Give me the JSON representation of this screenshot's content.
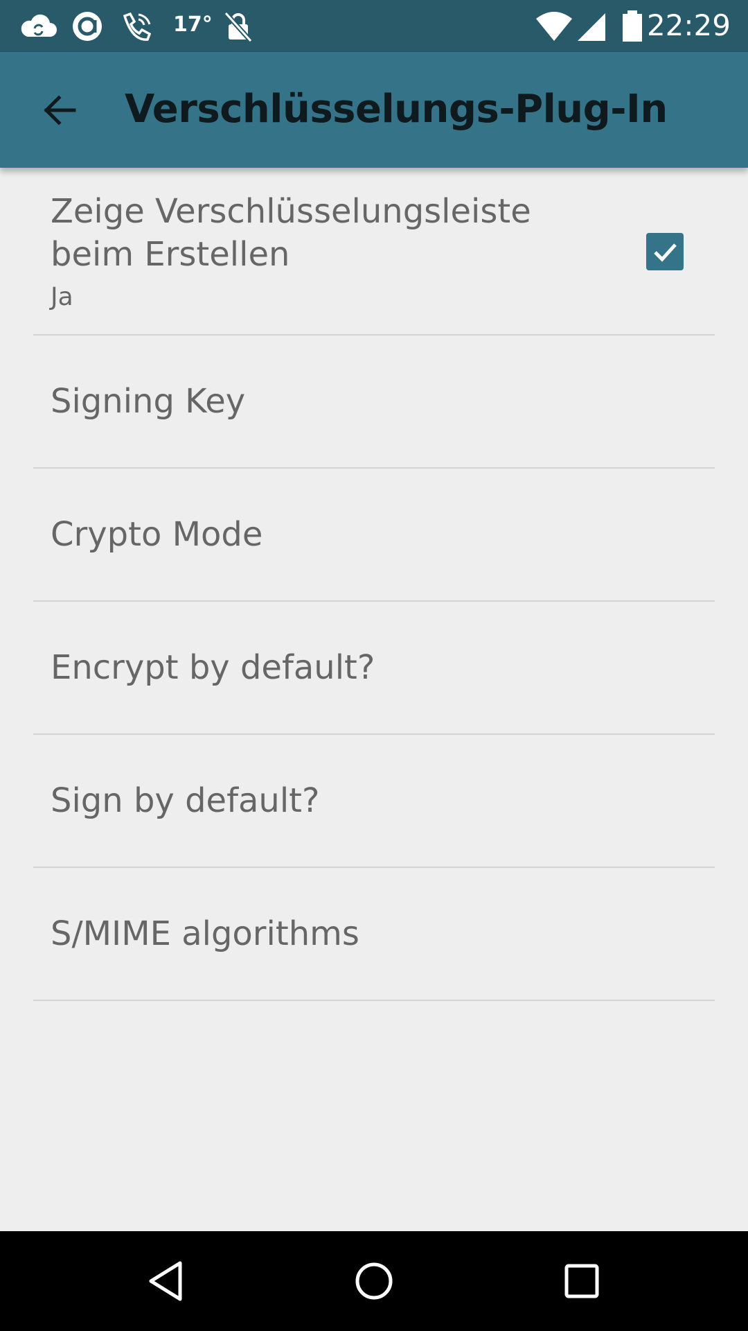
{
  "status_bar": {
    "temperature": "17°",
    "time": "22:29",
    "icons": [
      "cloud-sync-icon",
      "circle-app-icon",
      "phone-icon",
      "lock-off-icon",
      "wifi-icon",
      "signal-icon",
      "battery-icon"
    ]
  },
  "app_bar": {
    "back_icon": "arrow-left-icon",
    "title": "Verschlüsselungs-Plug-In"
  },
  "preferences": [
    {
      "title": "Zeige Verschlüsselungsleiste beim Erstellen",
      "summary": "Ja",
      "checked": true
    },
    {
      "title": "Signing Key"
    },
    {
      "title": "Crypto Mode"
    },
    {
      "title": "Encrypt by default?"
    },
    {
      "title": "Sign by default?"
    },
    {
      "title": "S/MIME algorithms"
    }
  ],
  "nav_bar": {
    "icons": [
      "back-triangle-icon",
      "home-circle-icon",
      "recents-square-icon"
    ]
  },
  "colors": {
    "status_bar": "#285a6a",
    "app_bar": "#357488",
    "background": "#eeeeee",
    "text": "#666666",
    "accent": "#357488"
  }
}
